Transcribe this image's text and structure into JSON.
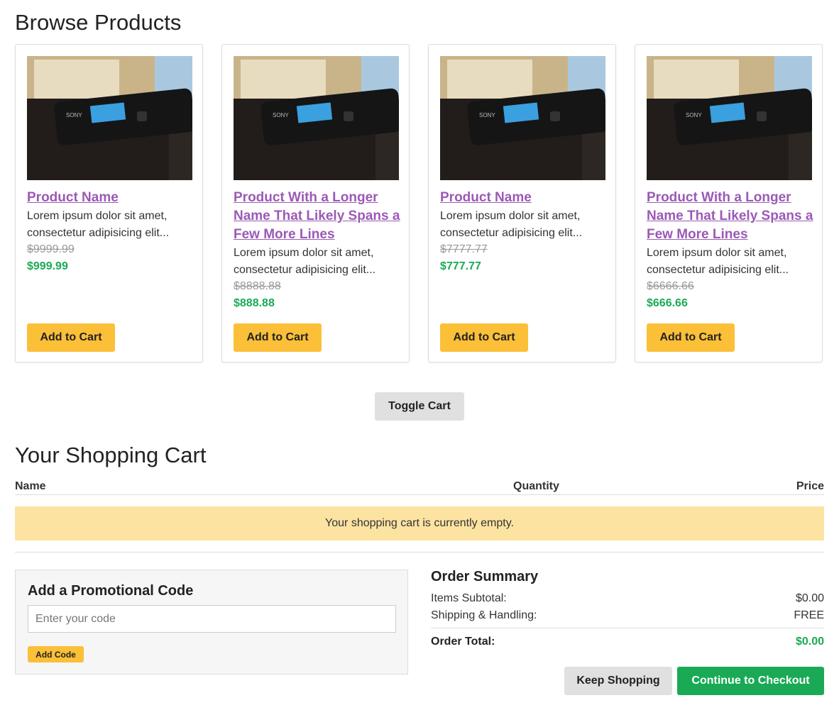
{
  "browse": {
    "title": "Browse Products",
    "add_to_cart_label": "Add to Cart",
    "products": [
      {
        "name": "Product Name",
        "description": "Lorem ipsum dolor sit amet, consectetur adipisicing elit...",
        "old_price": "$9999.99",
        "price": "$999.99"
      },
      {
        "name": "Product With a Longer Name That Likely Spans a Few More Lines",
        "description": "Lorem ipsum dolor sit amet, consectetur adipisicing elit...",
        "old_price": "$8888.88",
        "price": "$888.88"
      },
      {
        "name": "Product Name",
        "description": "Lorem ipsum dolor sit amet, consectetur adipisicing elit...",
        "old_price": "$7777.77",
        "price": "$777.77"
      },
      {
        "name": "Product With a Longer Name That Likely Spans a Few More Lines",
        "description": "Lorem ipsum dolor sit amet, consectetur adipisicing elit...",
        "old_price": "$6666.66",
        "price": "$666.66"
      }
    ]
  },
  "toggle_cart_label": "Toggle Cart",
  "cart": {
    "title": "Your Shopping Cart",
    "columns": {
      "name": "Name",
      "quantity": "Quantity",
      "price": "Price"
    },
    "empty_message": "Your shopping cart is currently empty."
  },
  "promo": {
    "title": "Add a Promotional Code",
    "placeholder": "Enter your code",
    "value": "",
    "button_label": "Add Code"
  },
  "summary": {
    "title": "Order Summary",
    "subtotal_label": "Items Subtotal:",
    "subtotal_value": "$0.00",
    "shipping_label": "Shipping & Handling:",
    "shipping_value": "FREE",
    "total_label": "Order Total:",
    "total_value": "$0.00",
    "keep_shopping_label": "Keep Shopping",
    "checkout_label": "Continue to Checkout"
  },
  "colors": {
    "accent_yellow": "#fbbf38",
    "link_purple": "#9b59b6",
    "price_green": "#1aaa55",
    "alert_bg": "#fde3a2"
  }
}
